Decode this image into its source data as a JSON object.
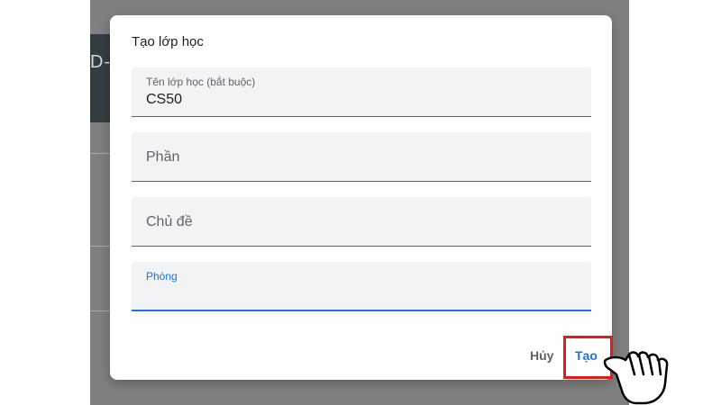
{
  "background": {
    "banner_text": "D-V"
  },
  "dialog": {
    "title": "Tạo lớp học",
    "fields": [
      {
        "label": "Tên lớp học (bắt buộc)",
        "value": "CS50"
      },
      {
        "placeholder": "Phần"
      },
      {
        "placeholder": "Chủ đề"
      },
      {
        "label": "Phòng",
        "value": ""
      }
    ],
    "actions": {
      "cancel_label": "Hủy",
      "create_label": "Tạo"
    }
  },
  "colors": {
    "accent": "#1a73e8",
    "highlight_box": "#e31b1b",
    "field_bg": "#f1f3f4"
  },
  "icons": {
    "pointer": "pointing-hand-cursor-icon"
  }
}
